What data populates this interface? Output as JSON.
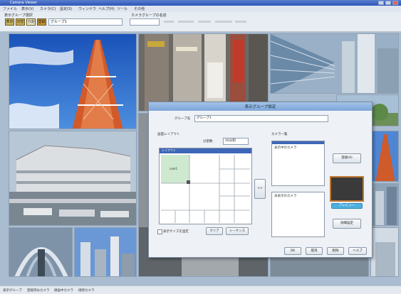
{
  "window": {
    "title": "Camera Viewer"
  },
  "menu": [
    "ファイル",
    "表示(V)",
    "カメラ(C)",
    "設定(S)",
    "ウィンドウ",
    "ヘルプ(H)",
    "ツール",
    "その他"
  ],
  "toolbar": {
    "group_label": "表示グループ選択",
    "buttons": [
      "表示",
      "切替",
      "分割",
      "登録"
    ],
    "group_value": "グループ1",
    "camera_label": "カメラグループの名前",
    "camera_value": ""
  },
  "dialog": {
    "title": "表示グループ設定",
    "name_label": "グループ名",
    "name_value": "グループ1",
    "layout_label": "画面レイアウト",
    "split_label": "分割数",
    "split_value": "16分割",
    "grid_header": "レイアウト",
    "grid_cell_label": "cam1",
    "camera_list_label": "カメラ一覧",
    "list_top_label": "表示中のカメラ",
    "list_bottom_label": "未表示のカメラ",
    "move_button": "<<",
    "checkbox_label": "表示サイズを固定",
    "clear_button": "クリア",
    "sequence_button": "シーケンス",
    "register_button": "登録(A)",
    "preview_button": "プレビュー",
    "settings_button": "詳細設定",
    "ok_button": "OK",
    "cancel_button": "取消",
    "delete_button": "削除",
    "help_button": "ヘルプ"
  },
  "status": [
    "表示グループ",
    "登録済みカメラ",
    "録画中カメラ",
    "接続カメラ"
  ],
  "colors": {
    "title_blue": "#2e55b5",
    "accent_button": "#c9b25a",
    "preview_dark": "#3a3a3a",
    "preview_orange": "#c0772e"
  }
}
